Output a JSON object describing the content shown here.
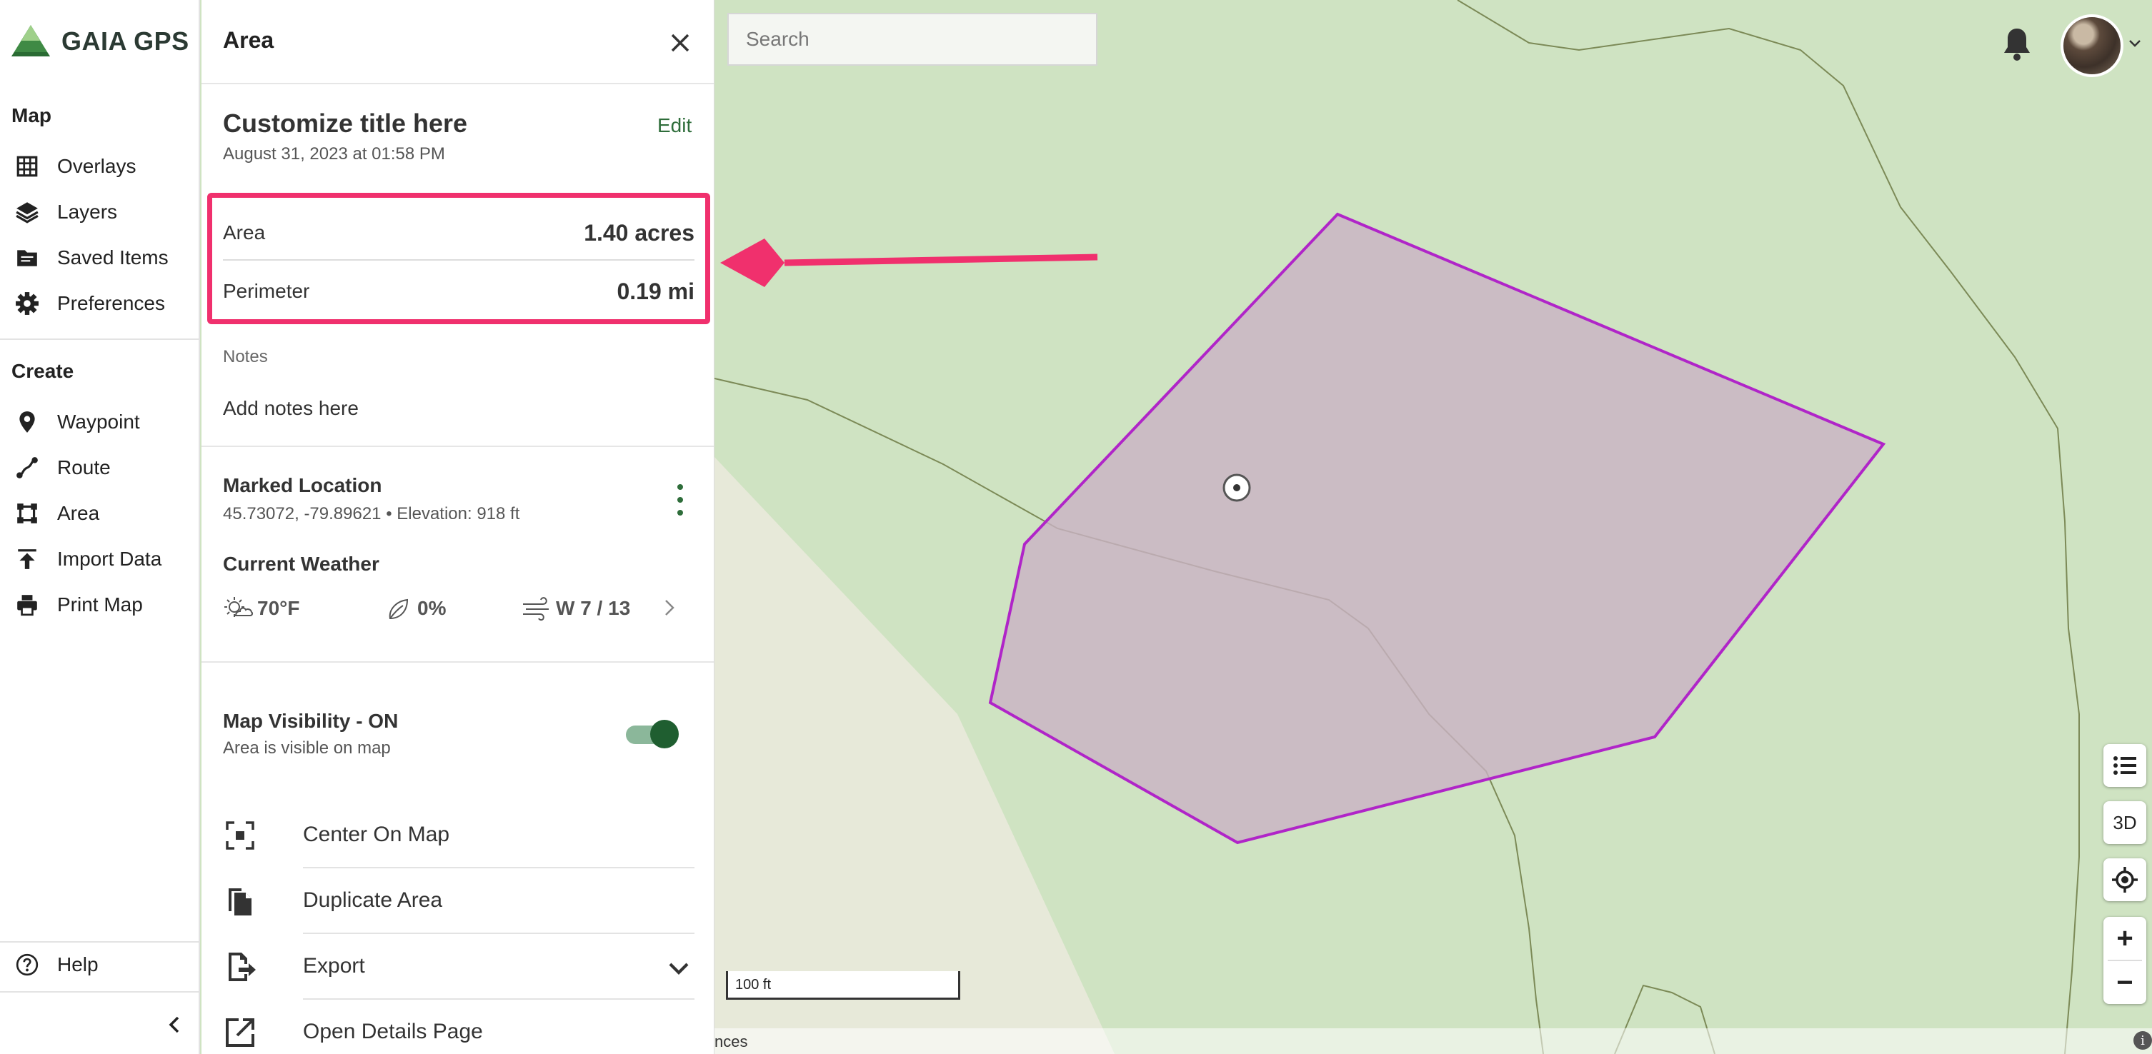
{
  "app": {
    "name": "GAIA GPS"
  },
  "colors": {
    "brand_green": "#2e6d3a",
    "highlight": "#f0306d",
    "polygon_stroke": "#b025c8"
  },
  "nav": {
    "map_heading": "Map",
    "map_items": [
      {
        "label": "Overlays",
        "icon": "grid-icon"
      },
      {
        "label": "Layers",
        "icon": "layers-icon"
      },
      {
        "label": "Saved Items",
        "icon": "folder-icon"
      },
      {
        "label": "Preferences",
        "icon": "gear-icon"
      }
    ],
    "create_heading": "Create",
    "create_items": [
      {
        "label": "Waypoint",
        "icon": "pin-icon"
      },
      {
        "label": "Route",
        "icon": "route-icon"
      },
      {
        "label": "Area",
        "icon": "area-icon"
      },
      {
        "label": "Import Data",
        "icon": "upload-icon"
      },
      {
        "label": "Print Map",
        "icon": "printer-icon"
      }
    ],
    "help_label": "Help"
  },
  "panel": {
    "title": "Area",
    "custom_title": "Customize title here",
    "date": "August 31, 2023 at 01:58 PM",
    "edit_label": "Edit",
    "stats": [
      {
        "key": "Area",
        "value": "1.40 acres"
      },
      {
        "key": "Perimeter",
        "value": "0.19 mi"
      }
    ],
    "notes_label": "Notes",
    "notes_placeholder": "Add notes here",
    "marked_location": {
      "title": "Marked Location",
      "coords": "45.73072, -79.89621 • Elevation: 918 ft"
    },
    "weather": {
      "title": "Current Weather",
      "temp": "70°F",
      "precip": "0%",
      "wind": "W 7 / 13"
    },
    "visibility": {
      "title": "Map Visibility - ON",
      "subtitle": "Area is visible on map",
      "on": true
    },
    "actions": [
      {
        "label": "Center On Map",
        "icon": "center-icon"
      },
      {
        "label": "Duplicate Area",
        "icon": "duplicate-icon"
      },
      {
        "label": "Export",
        "icon": "export-icon"
      },
      {
        "label": "Open Details Page",
        "icon": "external-link-icon"
      }
    ]
  },
  "map": {
    "search_placeholder": "Search",
    "button_3d": "3D",
    "zoom_in": "+",
    "zoom_out": "−",
    "scale_label": "100 ft",
    "attribution": "nces",
    "info": "i"
  }
}
